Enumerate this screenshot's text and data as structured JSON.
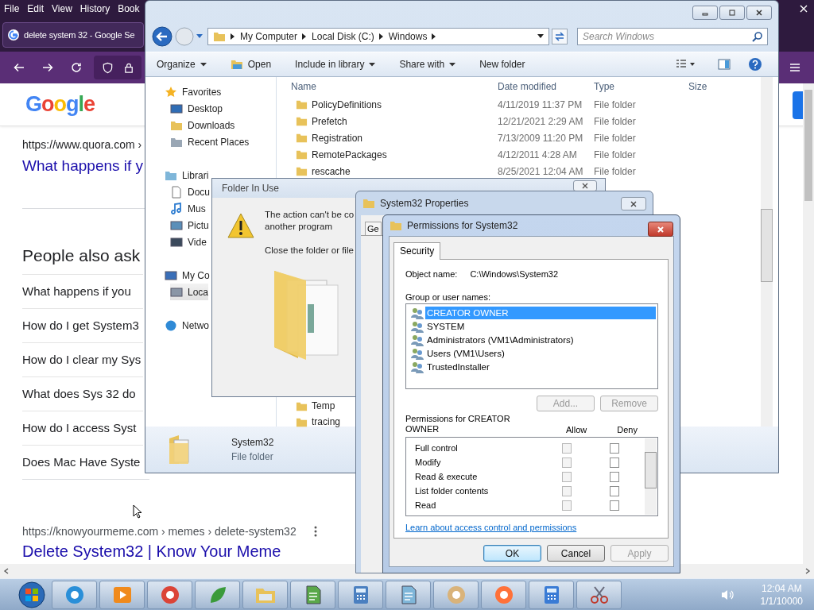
{
  "browser": {
    "menu": [
      "File",
      "Edit",
      "View",
      "History",
      "Book"
    ],
    "tab": {
      "title": "delete system 32 - Google Se",
      "selected": true
    },
    "logo": "Google",
    "result_1": {
      "url": "https://www.quora.com ›",
      "title": "What happens if y"
    },
    "people_also_ask": {
      "heading": "People also ask",
      "questions": [
        "What happens if you",
        "How do I get System3",
        "How do I clear my Sys",
        "What does Sys 32 do",
        "How do I access Syst",
        "Does Mac Have Syste"
      ]
    },
    "result_2": {
      "url": "https://knowyourmeme.com › memes › delete-system32",
      "title": "Delete System32 | Know Your Meme"
    }
  },
  "explorer": {
    "breadcrumbs": [
      "My Computer",
      "Local Disk (C:)",
      "Windows"
    ],
    "search": {
      "placeholder": "Search Windows"
    },
    "toolbar": [
      {
        "label": "Organize",
        "kind": "menu"
      },
      {
        "label": "Open",
        "kind": "open"
      },
      {
        "label": "Include in library",
        "kind": "menu"
      },
      {
        "label": "Share with",
        "kind": "menu"
      },
      {
        "label": "New folder",
        "kind": "plain"
      }
    ],
    "nav": [
      {
        "label": "Favorites",
        "kind": "favorites",
        "selected": false,
        "children": [
          {
            "label": "Desktop",
            "kind": "desktop",
            "selected": false
          },
          {
            "label": "Downloads",
            "kind": "downloads",
            "selected": false
          },
          {
            "label": "Recent Places",
            "kind": "recent",
            "selected": false
          }
        ]
      },
      {
        "label": "Librari",
        "kind": "libraries",
        "selected": false,
        "children": [
          {
            "label": "Docu",
            "kind": "document",
            "selected": false
          },
          {
            "label": "Mus",
            "kind": "music",
            "selected": false
          },
          {
            "label": "Pictu",
            "kind": "pictures",
            "selected": false
          },
          {
            "label": "Vide",
            "kind": "videos",
            "selected": false
          }
        ]
      },
      {
        "label": "My Co",
        "kind": "computer",
        "selected": false,
        "children": [
          {
            "label": "Loca",
            "kind": "disk",
            "selected": true
          }
        ]
      },
      {
        "label": "Netwo",
        "kind": "network",
        "selected": false
      }
    ],
    "columns": [
      "Name",
      "Date modified",
      "Type",
      "Size"
    ],
    "files": [
      {
        "name": "PolicyDefinitions",
        "date": "4/11/2019 11:37 PM",
        "type": "File folder"
      },
      {
        "name": "Prefetch",
        "date": "12/21/2021 2:29 AM",
        "type": "File folder"
      },
      {
        "name": "Registration",
        "date": "7/13/2009 11:20 PM",
        "type": "File folder"
      },
      {
        "name": "RemotePackages",
        "date": "4/12/2011 4:28 AM",
        "type": "File folder"
      },
      {
        "name": "rescache",
        "date": "8/25/2021 12:04 AM",
        "type": "File folder"
      }
    ],
    "files_lower": [
      "Temp",
      "tracing"
    ],
    "details": {
      "name": "System32",
      "type": "File folder"
    }
  },
  "folder_in_use": {
    "title": "Folder In Use",
    "message": [
      "The action can't be co",
      "another program"
    ],
    "hint": "Close the folder or file"
  },
  "properties": {
    "title": "System32 Properties",
    "tab": "Ge"
  },
  "permissions": {
    "title": "Permissions for System32",
    "tab": {
      "label": "Security",
      "selected": true
    },
    "object_label": "Object name:",
    "object_value": "C:\\Windows\\System32",
    "group_label": "Group or user names:",
    "users": [
      {
        "name": "CREATOR OWNER",
        "selected": true
      },
      {
        "name": "SYSTEM",
        "selected": false
      },
      {
        "name": "Administrators (VM1\\Administrators)",
        "selected": false
      },
      {
        "name": "Users (VM1\\Users)",
        "selected": false
      },
      {
        "name": "TrustedInstaller",
        "selected": false
      }
    ],
    "user_buttons": [
      {
        "label": "Add...",
        "disabled": true
      },
      {
        "label": "Remove",
        "disabled": true
      }
    ],
    "perm_label": "Permissions for CREATOR OWNER",
    "allow_label": "Allow",
    "deny_label": "Deny",
    "perms": [
      {
        "name": "Full control",
        "allow": false,
        "deny": false
      },
      {
        "name": "Modify",
        "allow": false,
        "deny": false
      },
      {
        "name": "Read & execute",
        "allow": false,
        "deny": false
      },
      {
        "name": "List folder contents",
        "allow": false,
        "deny": false
      },
      {
        "name": "Read",
        "allow": false,
        "deny": false
      }
    ],
    "link": "Learn about access control and permissions",
    "buttons": [
      {
        "label": "OK",
        "disabled": false,
        "default": true
      },
      {
        "label": "Cancel",
        "disabled": false,
        "default": false
      },
      {
        "label": "Apply",
        "disabled": true,
        "default": false
      }
    ]
  },
  "taskbar": {
    "apps": [
      {
        "kind": "ie"
      },
      {
        "kind": "media"
      },
      {
        "kind": "chrome"
      },
      {
        "kind": "app"
      },
      {
        "kind": "explorer"
      },
      {
        "kind": "notepad"
      },
      {
        "kind": "calc"
      },
      {
        "kind": "doc"
      },
      {
        "kind": "paint"
      },
      {
        "kind": "firefox"
      },
      {
        "kind": "control"
      },
      {
        "kind": "snip"
      }
    ],
    "time": "12:04 AM",
    "date": "1/1/10000"
  }
}
